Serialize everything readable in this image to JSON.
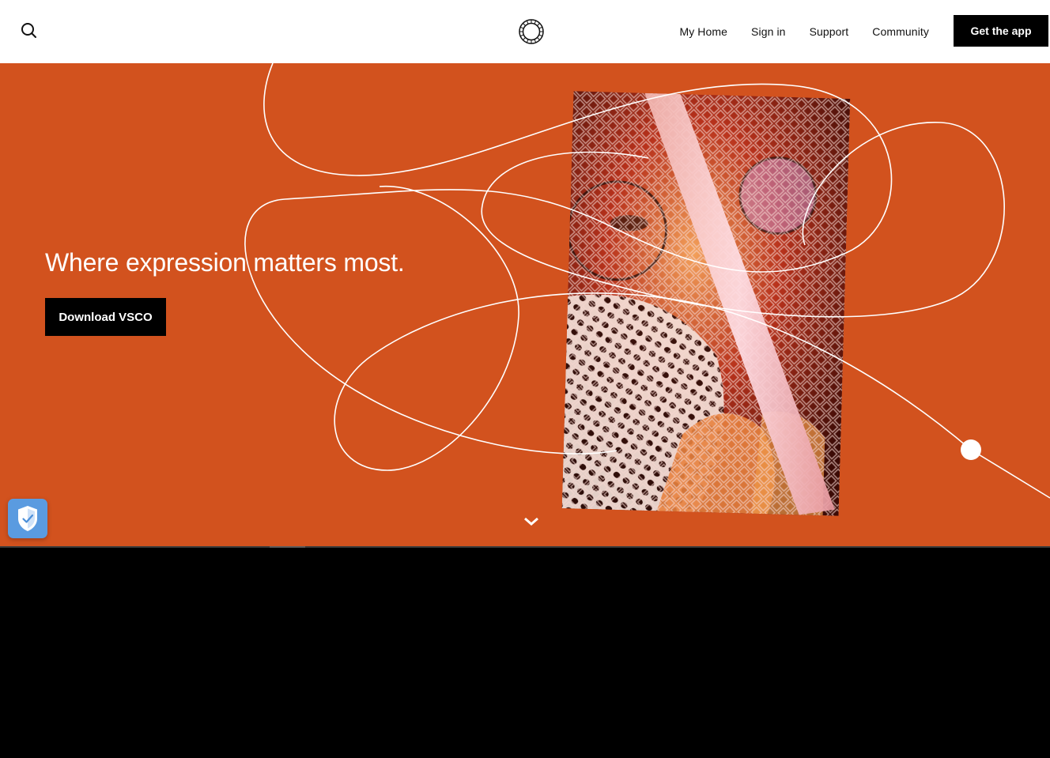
{
  "header": {
    "nav": [
      {
        "label": "My Home"
      },
      {
        "label": "Sign in"
      },
      {
        "label": "Support"
      },
      {
        "label": "Community"
      }
    ],
    "cta_label": "Get the app",
    "search_icon": "search-icon",
    "logo_icon": "vsco-logo-icon"
  },
  "hero": {
    "headline": "Where expression matters most.",
    "download_label": "Download VSCO",
    "background_color": "#d2521e",
    "scroll_icon": "chevron-down-icon",
    "photo_icon": "portrait-mesh-photo"
  },
  "privacy_badge": {
    "icon": "shield-check-icon",
    "color": "#5a9be0"
  },
  "carousel": {
    "progress": 0.034
  }
}
